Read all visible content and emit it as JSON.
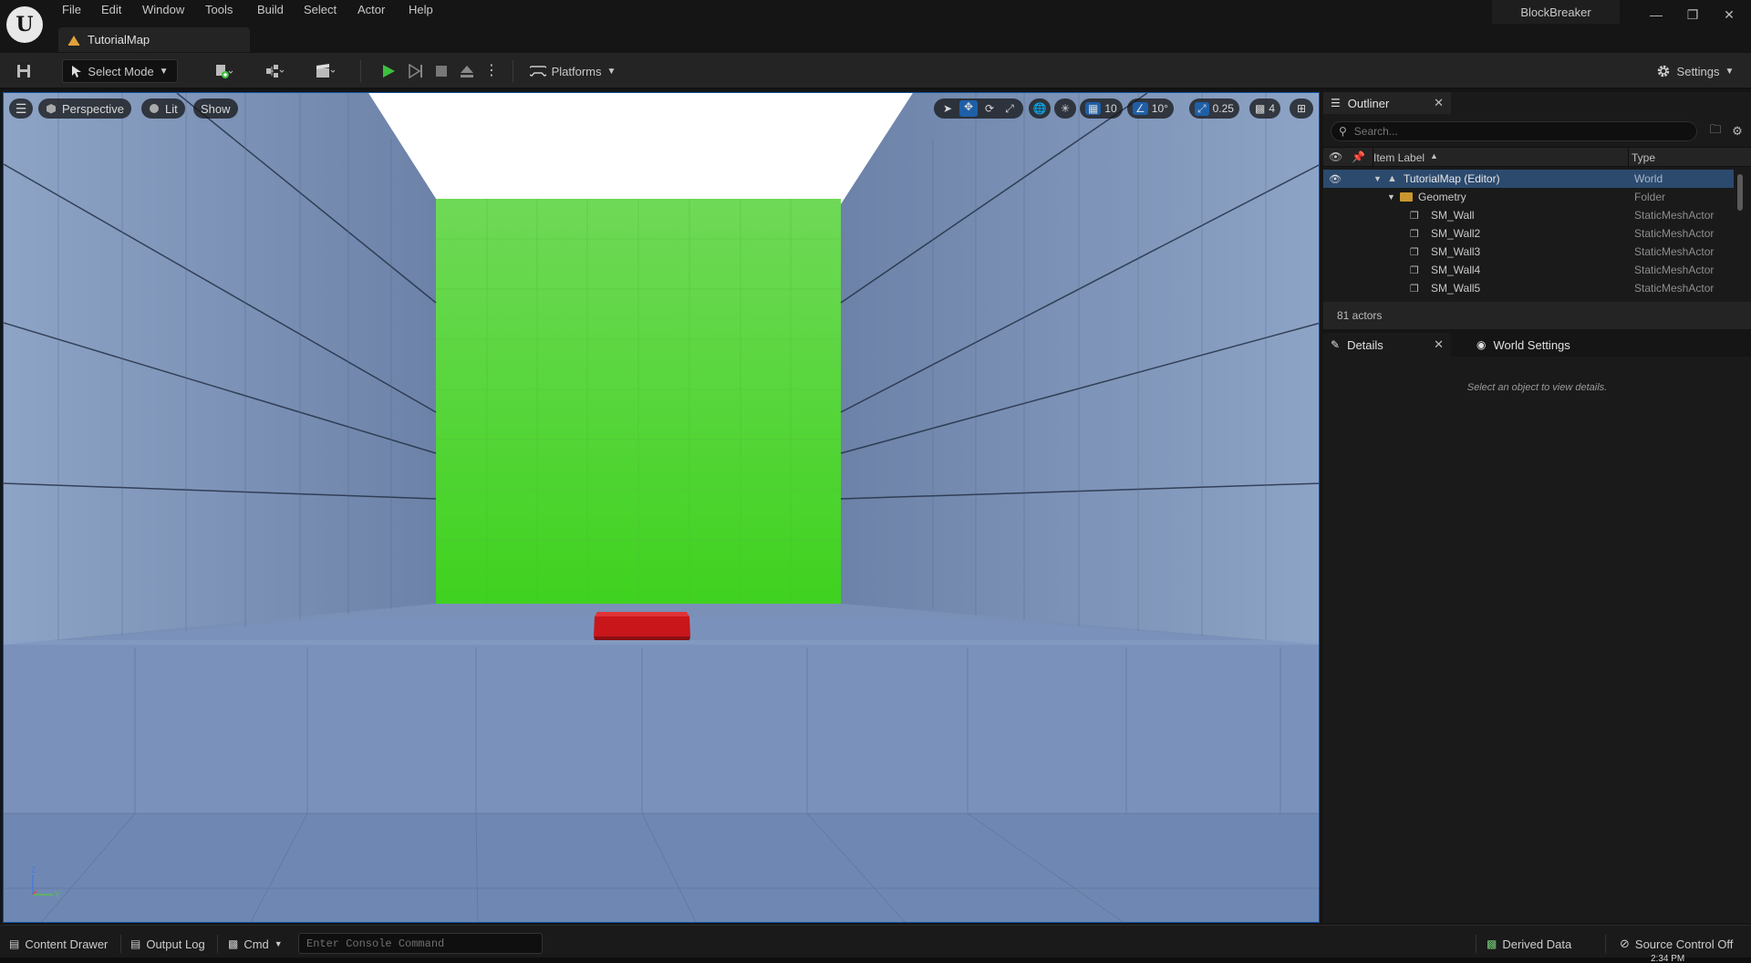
{
  "menu": [
    "File",
    "Edit",
    "Window",
    "Tools",
    "Build",
    "Select",
    "Actor",
    "Help"
  ],
  "map_tab": "TutorialMap",
  "project_name": "BlockBreaker",
  "toolbar": {
    "select_mode": "Select Mode",
    "platforms": "Platforms",
    "settings": "Settings"
  },
  "viewport": {
    "perspective": "Perspective",
    "lit": "Lit",
    "show": "Show",
    "grid_snap": "10",
    "rotation_snap": "10°",
    "scale_snap": "0.25",
    "camera_speed": "4",
    "axis_z": "Z",
    "axis_y": "Y"
  },
  "outliner": {
    "tab": "Outliner",
    "search_placeholder": "Search...",
    "col_label": "Item Label",
    "col_type": "Type",
    "rows": [
      {
        "label": "TutorialMap (Editor)",
        "type": "World"
      },
      {
        "label": "Geometry",
        "type": "Folder"
      },
      {
        "label": "SM_Wall",
        "type": "StaticMeshActor"
      },
      {
        "label": "SM_Wall2",
        "type": "StaticMeshActor"
      },
      {
        "label": "SM_Wall3",
        "type": "StaticMeshActor"
      },
      {
        "label": "SM_Wall4",
        "type": "StaticMeshActor"
      },
      {
        "label": "SM_Wall5",
        "type": "StaticMeshActor"
      }
    ],
    "actor_count": "81 actors"
  },
  "details": {
    "tab": "Details",
    "world_settings_tab": "World Settings",
    "empty_message": "Select an object to view details."
  },
  "statusbar": {
    "content_drawer": "Content Drawer",
    "output_log": "Output Log",
    "cmd": "Cmd",
    "console_placeholder": "Enter Console Command",
    "derived_data": "Derived Data",
    "source_control": "Source Control Off"
  },
  "clock": "2:34 PM",
  "colors": {
    "accent": "#1e88e5",
    "play_green": "#3fbf3f",
    "wall_green": "#55d63a",
    "block_red": "#c8161b",
    "selection": "#2c4a6e"
  }
}
